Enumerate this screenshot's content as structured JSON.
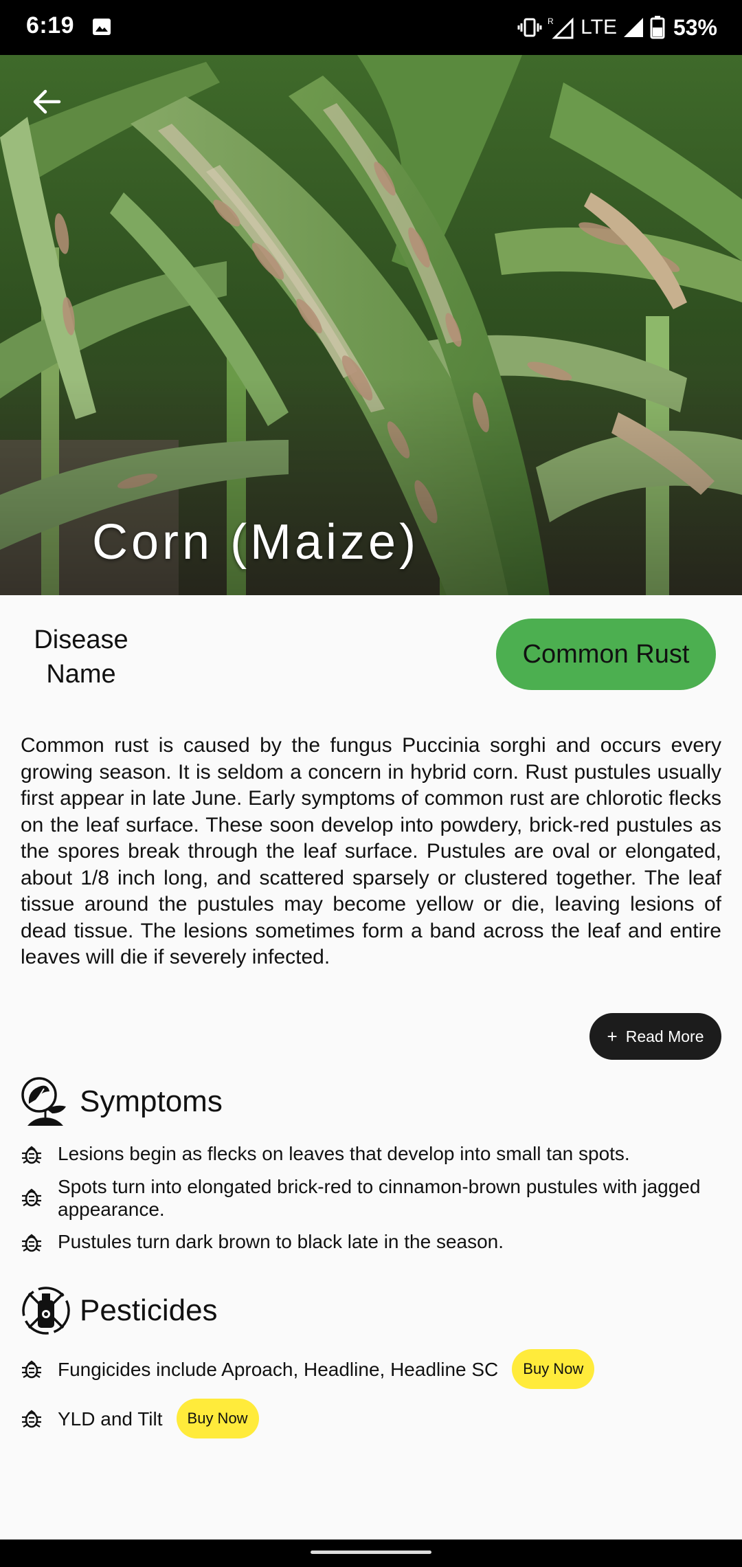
{
  "status_bar": {
    "time": "6:19",
    "network": "LTE",
    "roaming": "R",
    "battery": "53%",
    "icons": [
      "image-icon",
      "vibrate-icon",
      "signal-icon",
      "battery-icon"
    ]
  },
  "hero": {
    "title": "Corn (Maize)",
    "back_icon": "arrow-left-icon"
  },
  "disease": {
    "label": "Disease Name",
    "name": "Common Rust",
    "chip_color": "#4caf50"
  },
  "description": "Common rust is caused by the fungus Puccinia sorghi and occurs every growing season. It is seldom a concern in hybrid corn. Rust pustules usually first appear in late June. Early symptoms of common rust are chlorotic flecks on the leaf surface. These soon develop into powdery, brick-red pustules as the spores break through the leaf surface. Pustules are oval or elongated, about 1/8 inch long, and scattered sparsely or clustered together. The leaf tissue around the pustules may become yellow or die, leaving lesions of dead tissue. The lesions sometimes form a band across the leaf and entire leaves will die if severely infected.",
  "read_more": {
    "icon": "+",
    "label": "Read More"
  },
  "symptoms": {
    "title": "Symptoms",
    "items": [
      "Lesions begin as flecks on leaves that develop into small tan spots.",
      "Spots turn into elongated brick-red to cinnamon-brown pustules with jagged appearance.",
      "Pustules turn dark brown to black late in the season."
    ]
  },
  "pesticides": {
    "title": "Pesticides",
    "items": [
      {
        "text": "Fungicides include Aproach, Headline, Headline SC",
        "button": "Buy Now"
      },
      {
        "text": "YLD and Tilt",
        "button": "Buy Now"
      }
    ],
    "button_color": "#ffeb3b"
  }
}
